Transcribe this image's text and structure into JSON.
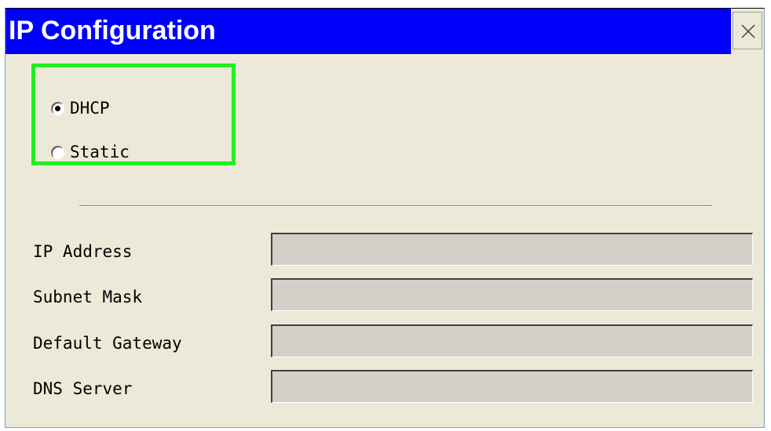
{
  "window": {
    "title": "IP Configuration",
    "close_glyph": "close-icon"
  },
  "mode": {
    "options": [
      {
        "label": "DHCP",
        "selected": true
      },
      {
        "label": "Static",
        "selected": false
      }
    ]
  },
  "fields": [
    {
      "label": "IP Address",
      "value": ""
    },
    {
      "label": "Subnet Mask",
      "value": ""
    },
    {
      "label": "Default Gateway",
      "value": ""
    },
    {
      "label": "DNS Server",
      "value": ""
    }
  ],
  "colors": {
    "titlebar": "#0000ff",
    "highlight": "#22ee22",
    "panel": "#ece9d8",
    "input_disabled": "#d4d0c8"
  }
}
